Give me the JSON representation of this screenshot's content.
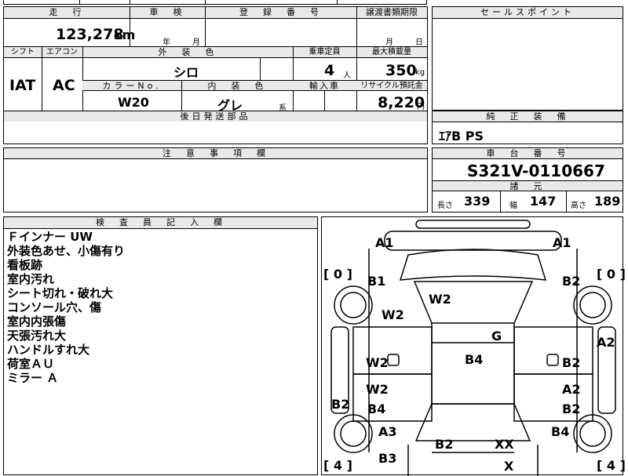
{
  "headers": {
    "mileage": "走　行",
    "inspection": "車　検",
    "registration": "登　録　番　号",
    "transfer_date": "譲渡書類期限",
    "sales_point": "セールスポイント",
    "shift": "シフト",
    "aircon": "エアコン",
    "exterior_color": "外　装　色",
    "capacity": "乗車定員",
    "max_load": "最大積載量",
    "color_no": "カラーNo.",
    "interior_color": "内　装　色",
    "import": "輸入車",
    "recycle": "リサイクル預託金",
    "later_parts": "後日発送部品",
    "genuine": "純　正　装　備",
    "notes": "注　意　事　項　欄",
    "chassis_no": "車　台　番　号",
    "specs": "諸　元",
    "inspector": "検　査　員　記　入　欄"
  },
  "values": {
    "mileage": "123,278",
    "mileage_unit": "km",
    "year_unit": "年",
    "month_unit": "月",
    "day_unit": "日",
    "shift": "IAT",
    "aircon": "AC",
    "exterior_color": "シロ",
    "capacity": "4",
    "capacity_unit": "人",
    "max_load": "350",
    "max_load_unit": "kg",
    "color_no": "W20",
    "interior_color": "グレ",
    "interior_suffix": "系",
    "recycle": "8,220",
    "recycle_unit": "円",
    "genuine": "ｴｱB PS",
    "chassis_no": "S321V-0110667",
    "length_label": "長さ",
    "length": "339",
    "width_label": "幅",
    "width": "147",
    "height_label": "高さ",
    "height": "189"
  },
  "inspector_notes": [
    "Ｆインナー UW",
    "外装色あせ、小傷有り",
    "看板跡",
    "室内汚れ",
    "シート切れ・破れ大",
    "コンソール穴、傷",
    "室内内張傷",
    "天張汚れ大",
    "ハンドルすれ大",
    "荷室ＡＵ",
    "ミラー Ａ"
  ],
  "diagram": {
    "marks": {
      "front_left": "A1",
      "front_right": "A1",
      "tire_fl_bracket": "[ 0 ]",
      "tire_fr_bracket": "[ 0 ]",
      "fender_left": "B1",
      "fender_right": "B2",
      "hood": "W2",
      "windshield_left": "W2",
      "center_top": "G",
      "side_right": "A2",
      "door_left_front": "W2",
      "roof": "B4",
      "door_right_front": "B2",
      "door_left_rear_a": "W2",
      "door_right_rear_a": "A2",
      "side_left": "B2",
      "door_left_rear_b": "B4",
      "door_right_rear_b": "B2",
      "quarter_left": "A3",
      "quarter_right": "B4",
      "rear_center_left": "B2",
      "rear_center_right": "XX",
      "rear_left": "B3",
      "rear_bottom": "X",
      "tire_rl_bracket": "[ 4 ]",
      "tire_rr_bracket": "[ 4 ]"
    }
  }
}
